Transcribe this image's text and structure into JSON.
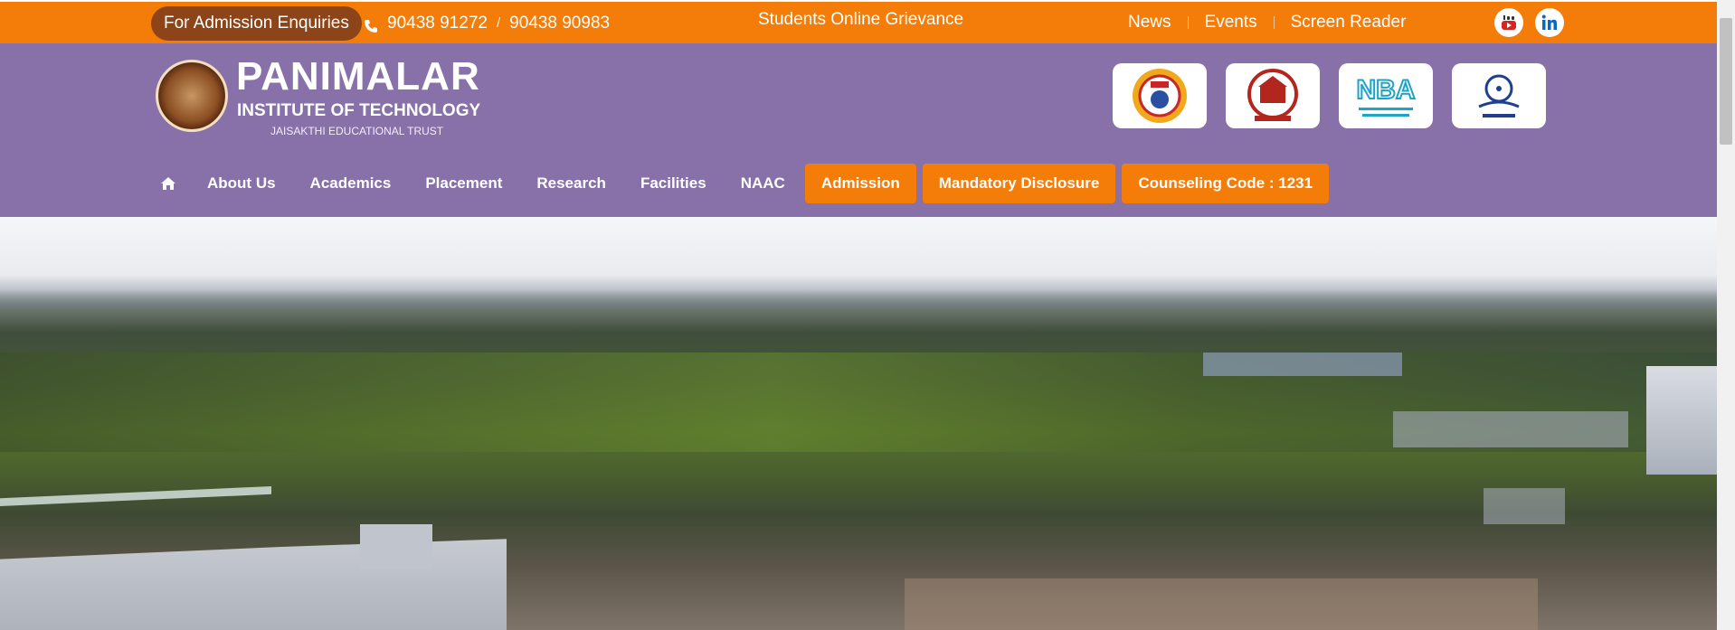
{
  "topbar": {
    "enquiry_label": "For Admission Enquiries",
    "phone_icon": "phone-icon",
    "phone_1": "90438 91272",
    "phone_separator": "/",
    "phone_2": "90438 90983",
    "grievance_label": "Students Online Grievance",
    "links": [
      "News",
      "Events",
      "Screen Reader"
    ],
    "social": [
      "youtube-icon",
      "linkedin-icon"
    ]
  },
  "header": {
    "brand_name": "PANIMALAR",
    "brand_sub": "INSTITUTE OF TECHNOLOGY",
    "brand_trust": "JAISAKTHI EDUCATIONAL TRUST",
    "accreditation_logos": [
      "aicte-logo",
      "anna-university-logo",
      "nba-logo",
      "ugc-logo"
    ],
    "accreditation_text": {
      "nba": "NBA"
    }
  },
  "nav": {
    "home_icon": "home-icon",
    "items": [
      "About Us",
      "Academics",
      "Placement",
      "Research",
      "Facilities",
      "NAAC"
    ],
    "buttons": [
      "Admission",
      "Mandatory Disclosure",
      "Counseling Code : 1231"
    ]
  },
  "colors": {
    "accent_orange": "#f47d0a",
    "header_purple": "#8870a9",
    "pill_brown": "#8c4418"
  }
}
